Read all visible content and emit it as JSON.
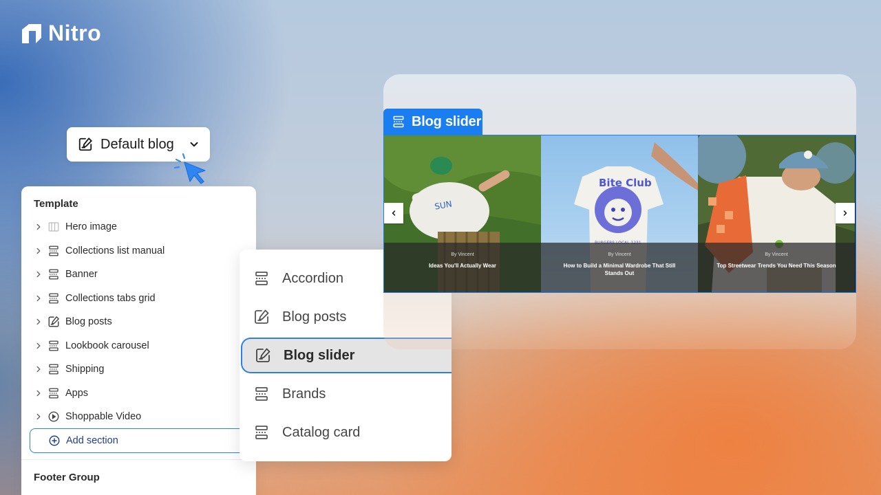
{
  "brand": {
    "name": "Nitro"
  },
  "blog_picker": {
    "label": "Default blog",
    "icon": "edit-note-icon",
    "chevron": "chevron-down-icon"
  },
  "template_panel": {
    "heading": "Template",
    "items": [
      {
        "label": "Hero image",
        "icon": "image-icon"
      },
      {
        "label": "Collections list manual",
        "icon": "section-icon"
      },
      {
        "label": "Banner",
        "icon": "section-icon"
      },
      {
        "label": "Collections tabs grid",
        "icon": "section-icon"
      },
      {
        "label": "Blog posts",
        "icon": "edit-note-icon"
      },
      {
        "label": "Lookbook carousel",
        "icon": "section-icon"
      },
      {
        "label": "Shipping",
        "icon": "section-icon"
      },
      {
        "label": "Apps",
        "icon": "section-icon"
      },
      {
        "label": "Shoppable Video",
        "icon": "play-circle-icon"
      }
    ],
    "add_section_label": "Add section",
    "footer_heading": "Footer Group"
  },
  "dropdown": {
    "items": [
      {
        "label": "Accordion",
        "icon": "section-icon",
        "selected": false
      },
      {
        "label": "Blog posts",
        "icon": "edit-note-icon",
        "selected": false
      },
      {
        "label": "Blog slider",
        "icon": "edit-note-icon",
        "selected": true
      },
      {
        "label": "Brands",
        "icon": "section-icon",
        "selected": false
      },
      {
        "label": "Catalog card",
        "icon": "section-icon",
        "selected": false
      }
    ]
  },
  "preview": {
    "tag_label": "Blog slider",
    "slides": [
      {
        "byline": "By Vincent",
        "title": "Ideas You'll Actually Wear"
      },
      {
        "byline": "By Vincent",
        "title": "How to Build a Minimal Wardrobe That Still Stands Out"
      },
      {
        "byline": "By Vincent",
        "title": "Top Streetwear Trends You Need This Season"
      }
    ]
  },
  "colors": {
    "accent": "#1a7df0",
    "add_text": "#1d3f8f",
    "selected_bg": "#e4e4e4"
  }
}
